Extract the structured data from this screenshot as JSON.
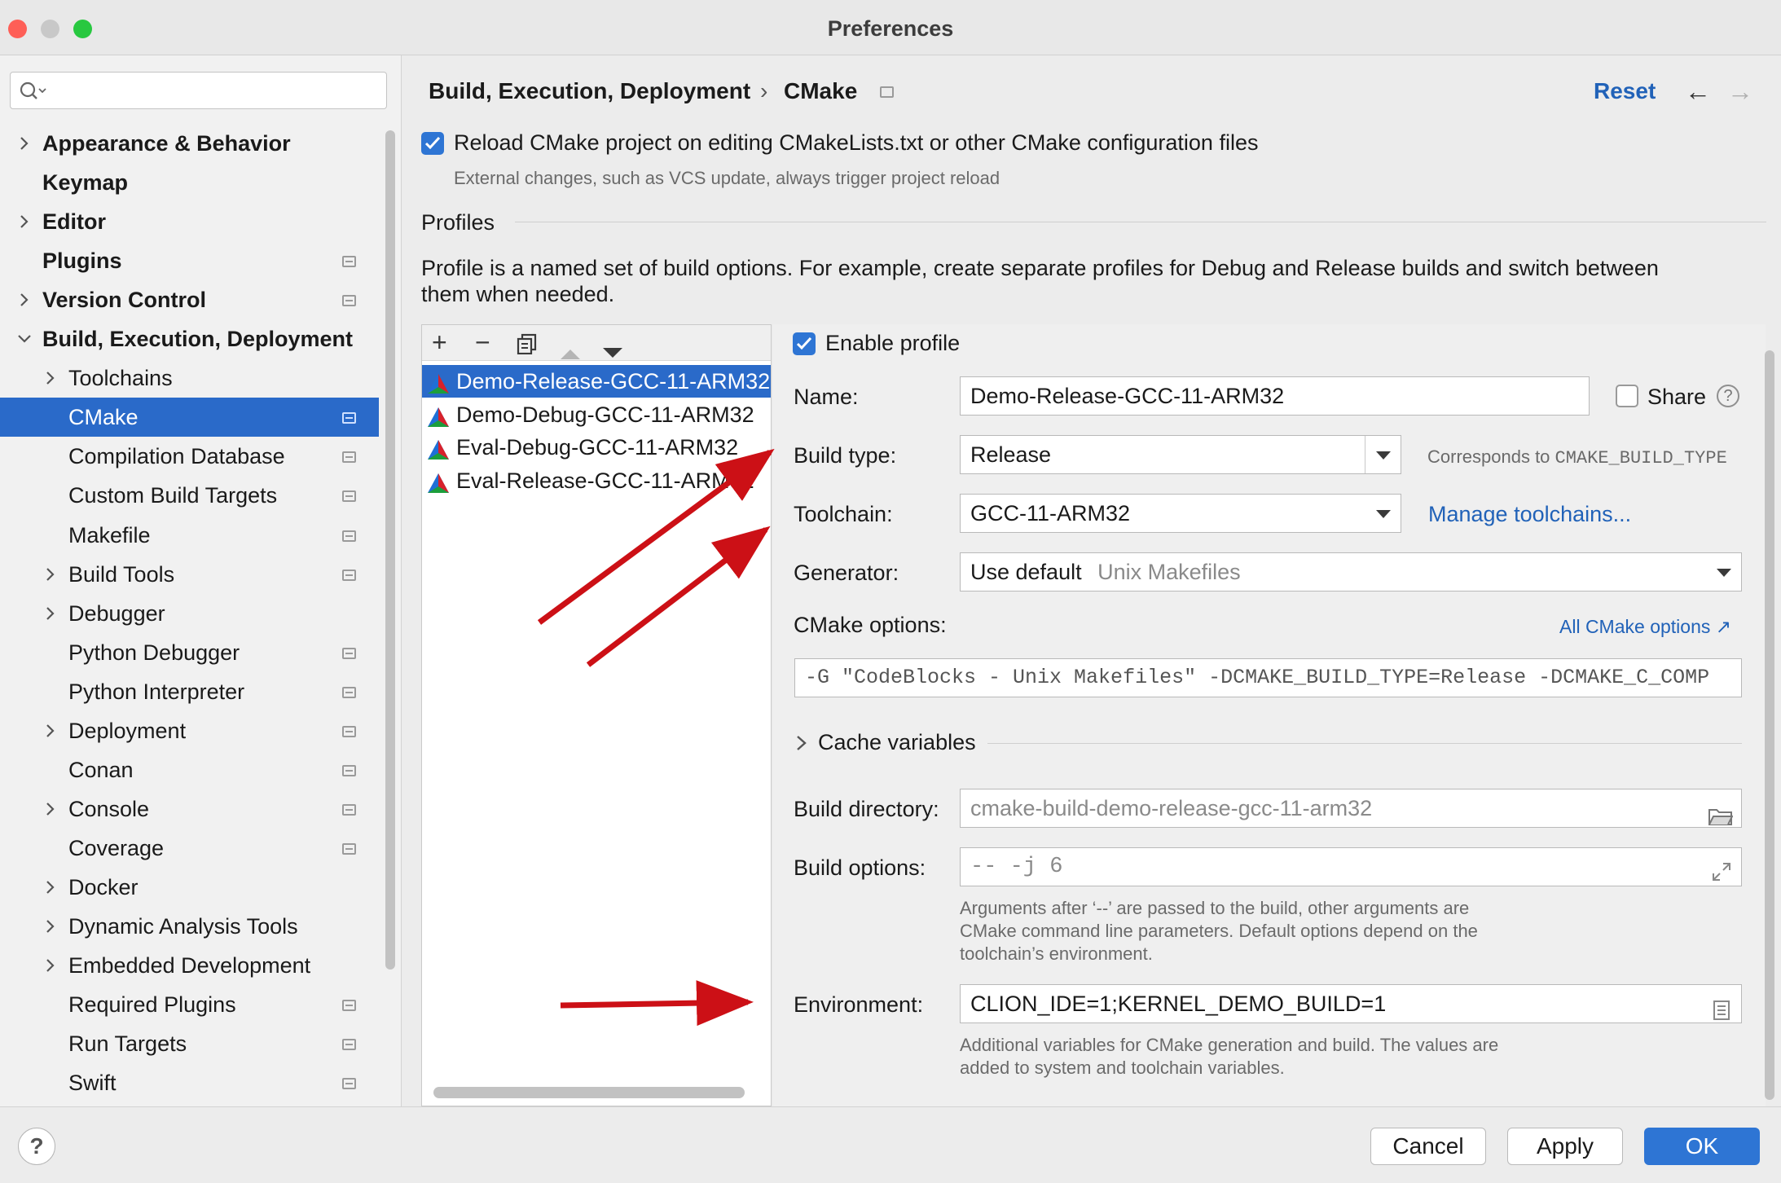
{
  "window": {
    "title": "Preferences",
    "traffic_lights": {
      "close": "#fe5f57",
      "minimize": "#c8c8c8",
      "zoom": "#28c840"
    }
  },
  "sidebar": {
    "search_placeholder": "",
    "items": [
      {
        "label": "Appearance & Behavior",
        "expandable": true,
        "expanded": false,
        "pinned": false
      },
      {
        "label": "Keymap",
        "expandable": false,
        "pinned": false
      },
      {
        "label": "Editor",
        "expandable": true,
        "expanded": false,
        "pinned": false
      },
      {
        "label": "Plugins",
        "expandable": false,
        "pinned": true
      },
      {
        "label": "Version Control",
        "expandable": true,
        "expanded": false,
        "pinned": true
      },
      {
        "label": "Build, Execution, Deployment",
        "expandable": true,
        "expanded": true,
        "pinned": false
      },
      {
        "label": "Toolchains",
        "expandable": true,
        "pinned": false,
        "child": true
      },
      {
        "label": "CMake",
        "expandable": false,
        "pinned": true,
        "child": true,
        "selected": true
      },
      {
        "label": "Compilation Database",
        "expandable": false,
        "pinned": true,
        "child": true
      },
      {
        "label": "Custom Build Targets",
        "expandable": false,
        "pinned": true,
        "child": true
      },
      {
        "label": "Makefile",
        "expandable": false,
        "pinned": true,
        "child": true
      },
      {
        "label": "Build Tools",
        "expandable": true,
        "pinned": true,
        "child": true
      },
      {
        "label": "Debugger",
        "expandable": true,
        "pinned": false,
        "child": true
      },
      {
        "label": "Python Debugger",
        "expandable": false,
        "pinned": true,
        "child": true
      },
      {
        "label": "Python Interpreter",
        "expandable": false,
        "pinned": true,
        "child": true
      },
      {
        "label": "Deployment",
        "expandable": true,
        "pinned": true,
        "child": true
      },
      {
        "label": "Conan",
        "expandable": false,
        "pinned": true,
        "child": true
      },
      {
        "label": "Console",
        "expandable": true,
        "pinned": true,
        "child": true
      },
      {
        "label": "Coverage",
        "expandable": false,
        "pinned": true,
        "child": true
      },
      {
        "label": "Docker",
        "expandable": true,
        "pinned": false,
        "child": true
      },
      {
        "label": "Dynamic Analysis Tools",
        "expandable": true,
        "pinned": false,
        "child": true
      },
      {
        "label": "Embedded Development",
        "expandable": true,
        "pinned": false,
        "child": true
      },
      {
        "label": "Required Plugins",
        "expandable": false,
        "pinned": true,
        "child": true
      },
      {
        "label": "Run Targets",
        "expandable": false,
        "pinned": true,
        "child": true
      },
      {
        "label": "Swift",
        "expandable": false,
        "pinned": true,
        "child": true
      }
    ]
  },
  "header": {
    "breadcrumb_parent": "Build, Execution, Deployment",
    "breadcrumb_separator": "›",
    "breadcrumb_current": "CMake",
    "reset_label": "Reset",
    "back_icon": "←",
    "forward_icon": "→"
  },
  "reload": {
    "checked": true,
    "label": "Reload CMake project on editing CMakeLists.txt or other CMake configuration files",
    "hint": "External changes, such as VCS update, always trigger project reload"
  },
  "profiles": {
    "section_title": "Profiles",
    "description_line1": "Profile is a named set of build options. For example, create separate profiles for Debug and Release builds and switch between",
    "description_line2": "them when needed.",
    "toolbar_icons": [
      "plus-icon",
      "minus-icon",
      "copy-icon",
      "move-up-icon",
      "move-down-icon"
    ],
    "list": [
      {
        "name": "Demo-Release-GCC-11-ARM32",
        "selected": true
      },
      {
        "name": "Demo-Debug-GCC-11-ARM32",
        "selected": false
      },
      {
        "name": "Eval-Debug-GCC-11-ARM32",
        "selected": false
      },
      {
        "name": "Eval-Release-GCC-11-ARM32",
        "selected": false
      }
    ]
  },
  "form": {
    "enable_profile_label": "Enable profile",
    "enable_profile_checked": true,
    "name_label": "Name:",
    "name_value": "Demo-Release-GCC-11-ARM32",
    "share_label": "Share",
    "share_checked": false,
    "help_glyph": "?",
    "build_type_label": "Build type:",
    "build_type_value": "Release",
    "build_type_hint_prefix": "Corresponds to ",
    "build_type_hint_code": "CMAKE_BUILD_TYPE",
    "toolchain_label": "Toolchain:",
    "toolchain_value": "GCC-11-ARM32",
    "manage_toolchains_link": "Manage toolchains...",
    "generator_label": "Generator:",
    "generator_value": "Use default",
    "generator_default_hint": "Unix Makefiles",
    "cmake_options_label": "CMake options:",
    "all_cmake_options_link": "All CMake options ↗",
    "cmake_options_value": "-G \"CodeBlocks - Unix Makefiles\" -DCMAKE_BUILD_TYPE=Release -DCMAKE_C_COMP",
    "cache_variables_label": "Cache variables",
    "build_directory_label": "Build directory:",
    "build_directory_value": "cmake-build-demo-release-gcc-11-arm32",
    "build_options_label": "Build options:",
    "build_options_value": "-- -j 6",
    "build_options_hint_1": "Arguments after ‘--’ are passed to the build, other arguments are",
    "build_options_hint_2": "CMake command line parameters. Default options depend on the",
    "build_options_hint_3": "toolchain’s environment.",
    "environment_label": "Environment:",
    "environment_value": "CLION_IDE=1;KERNEL_DEMO_BUILD=1",
    "environment_hint_1": "Additional variables for CMake generation and build. The values are",
    "environment_hint_2": "added to system and toolchain variables."
  },
  "footer": {
    "help_label": "?",
    "cancel_label": "Cancel",
    "apply_label": "Apply",
    "ok_label": "OK"
  },
  "colors": {
    "accent": "#2a6ac9",
    "link": "#2162b8",
    "annotation_arrow": "#cc1016"
  }
}
